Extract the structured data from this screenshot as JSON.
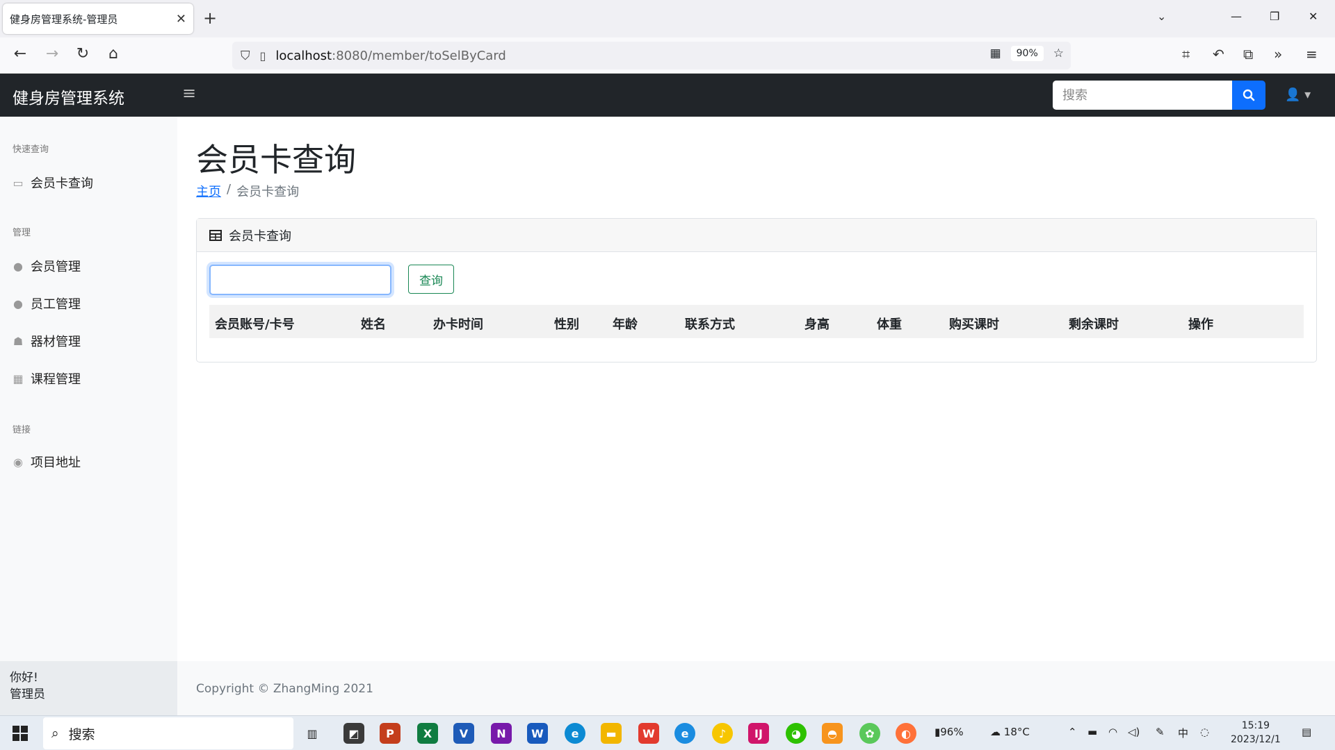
{
  "browser": {
    "tab_title": "健身房管理系统-管理员",
    "url_host": "localhost",
    "url_path": ":8080/member/toSelByCard",
    "zoom": "90%"
  },
  "app": {
    "brand": "健身房管理系统",
    "search_placeholder": "搜索"
  },
  "sidebar": {
    "sections": [
      {
        "heading": "快速查询",
        "items": [
          {
            "label": "会员卡查询",
            "icon": "id-card-icon"
          }
        ]
      },
      {
        "heading": "管理",
        "items": [
          {
            "label": "会员管理",
            "icon": "user-icon"
          },
          {
            "label": "员工管理",
            "icon": "user-tie-icon"
          },
          {
            "label": "器材管理",
            "icon": "equipment-icon"
          },
          {
            "label": "课程管理",
            "icon": "calendar-icon"
          }
        ]
      },
      {
        "heading": "链接",
        "items": [
          {
            "label": "项目地址",
            "icon": "github-icon"
          }
        ]
      }
    ],
    "footer_greeting": "你好!",
    "footer_role": "管理员"
  },
  "main": {
    "title": "会员卡查询",
    "breadcrumb_home": "主页",
    "breadcrumb_sep": "/",
    "breadcrumb_current": "会员卡查询",
    "card_title": "会员卡查询",
    "input_value": "",
    "query_button": "查询",
    "columns": [
      "会员账号/卡号",
      "姓名",
      "办卡时间",
      "性别",
      "年龄",
      "联系方式",
      "身高",
      "体重",
      "购买课时",
      "剩余课时",
      "操作"
    ]
  },
  "footer": {
    "copyright": "Copyright © ZhangMing 2021"
  },
  "taskbar": {
    "search_label": "搜索",
    "battery": "96%",
    "weather": "18°C",
    "time": "15:19",
    "date": "2023/12/1"
  },
  "colors": {
    "navbar": "#212529",
    "primary": "#0d6efd",
    "success": "#198754"
  }
}
